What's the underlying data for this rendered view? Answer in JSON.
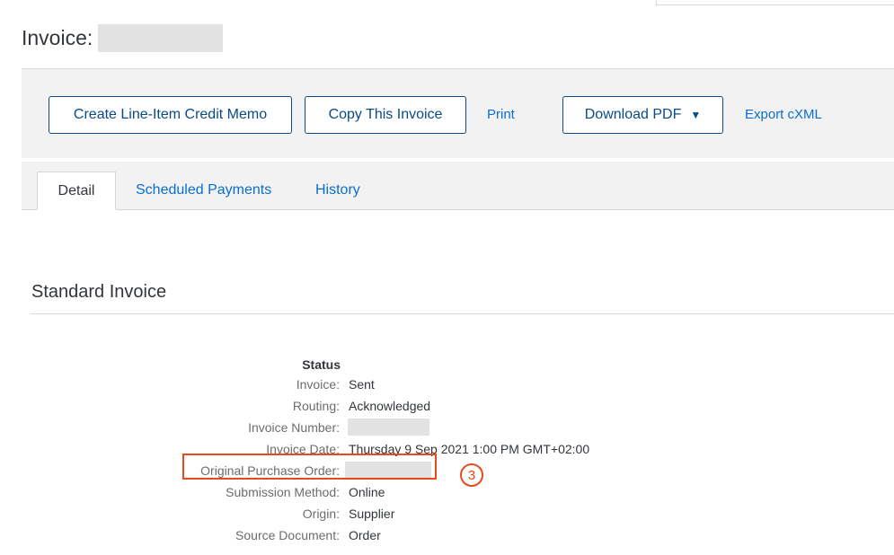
{
  "header": {
    "title": "Invoice:"
  },
  "toolbar": {
    "credit_memo_label": "Create Line-Item Credit Memo",
    "copy_invoice_label": "Copy This Invoice",
    "print_label": "Print",
    "download_pdf_label": "Download PDF",
    "download_caret": "▼",
    "export_cxml_label": "Export cXML"
  },
  "tabs": [
    {
      "label": "Detail",
      "active": true
    },
    {
      "label": "Scheduled Payments",
      "active": false
    },
    {
      "label": "History",
      "active": false
    }
  ],
  "section": {
    "title": "Standard Invoice"
  },
  "details": {
    "heading": "Status",
    "rows": [
      {
        "label": "Invoice:",
        "value": "Sent"
      },
      {
        "label": "Routing:",
        "value": "Acknowledged"
      },
      {
        "label": "Invoice Number:",
        "value": ""
      },
      {
        "label": "Invoice Date:",
        "value": "Thursday 9 Sep 2021 1:00 PM GMT+02:00"
      },
      {
        "label": "Original Purchase Order:",
        "value": ""
      },
      {
        "label": "Submission Method:",
        "value": "Online"
      },
      {
        "label": "Origin:",
        "value": "Supplier"
      },
      {
        "label": "Source Document:",
        "value": "Order"
      }
    ]
  },
  "annotation": {
    "step_number": "3",
    "color": "#e8491d"
  },
  "colors": {
    "link": "#0a6ed1",
    "button_border": "#0a4a85",
    "toolbar_bg": "#f2f2f2"
  }
}
